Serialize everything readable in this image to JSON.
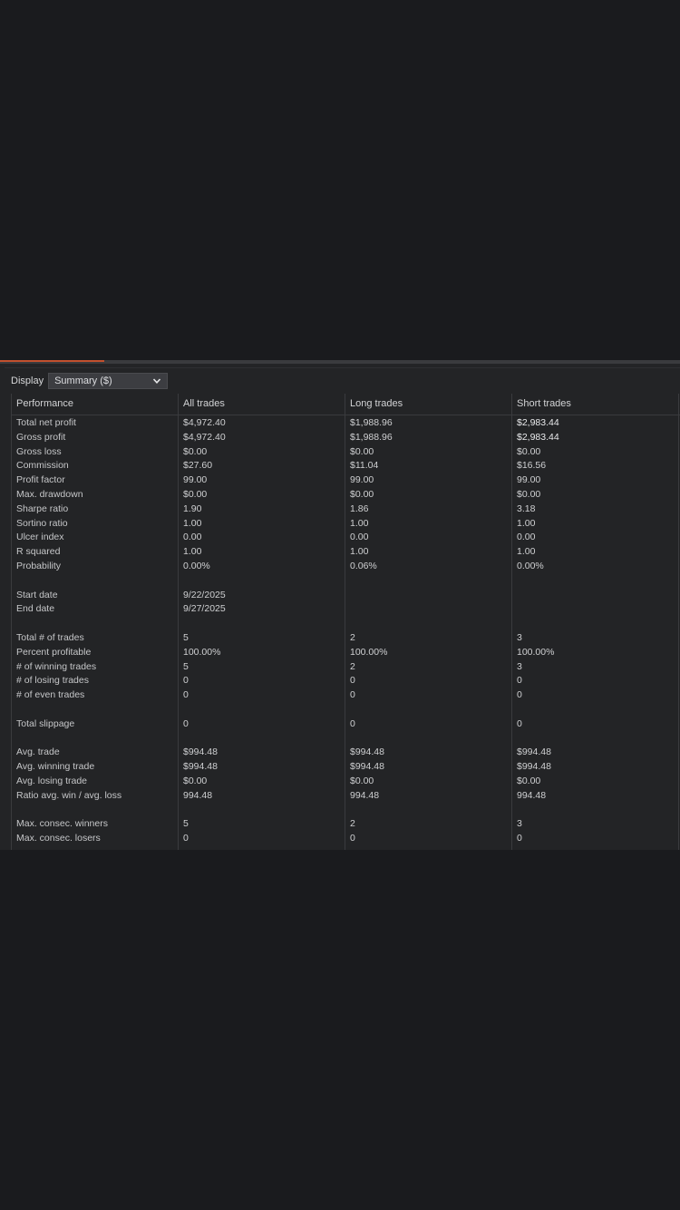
{
  "display": {
    "label": "Display",
    "selected": "Summary ($)",
    "dropdown_icon": "chevron-down-icon"
  },
  "colors": {
    "background": "#1a1b1e",
    "panel": "#232426",
    "accent": "#c2502e",
    "grid": "#3a3b3e",
    "text": "#cfd0d2"
  },
  "table": {
    "headers": [
      "Performance",
      "All trades",
      "Long trades",
      "Short trades"
    ],
    "rows": [
      {
        "label": "Total net profit",
        "all": "$4,972.40",
        "long": "$1,988.96",
        "short": "$2,983.44"
      },
      {
        "label": "Gross profit",
        "all": "$4,972.40",
        "long": "$1,988.96",
        "short": "$2,983.44"
      },
      {
        "label": "Gross loss",
        "all": "$0.00",
        "long": "$0.00",
        "short": "$0.00"
      },
      {
        "label": "Commission",
        "all": "$27.60",
        "long": "$11.04",
        "short": "$16.56"
      },
      {
        "label": "Profit factor",
        "all": "99.00",
        "long": "99.00",
        "short": "99.00"
      },
      {
        "label": "Max. drawdown",
        "all": "$0.00",
        "long": "$0.00",
        "short": "$0.00"
      },
      {
        "label": "Sharpe ratio",
        "all": "1.90",
        "long": "1.86",
        "short": "3.18"
      },
      {
        "label": "Sortino ratio",
        "all": "1.00",
        "long": "1.00",
        "short": "1.00"
      },
      {
        "label": "Ulcer index",
        "all": "0.00",
        "long": "0.00",
        "short": "0.00"
      },
      {
        "label": "R squared",
        "all": "1.00",
        "long": "1.00",
        "short": "1.00"
      },
      {
        "label": "Probability",
        "all": "0.00%",
        "long": "0.06%",
        "short": "0.00%"
      },
      {
        "label": "",
        "all": "",
        "long": "",
        "short": ""
      },
      {
        "label": "Start date",
        "all": "9/22/2025",
        "long": "",
        "short": ""
      },
      {
        "label": "End date",
        "all": "9/27/2025",
        "long": "",
        "short": ""
      },
      {
        "label": "",
        "all": "",
        "long": "",
        "short": ""
      },
      {
        "label": "Total # of trades",
        "all": "5",
        "long": "2",
        "short": "3"
      },
      {
        "label": "Percent profitable",
        "all": "100.00%",
        "long": "100.00%",
        "short": "100.00%"
      },
      {
        "label": "# of winning trades",
        "all": "5",
        "long": "2",
        "short": "3"
      },
      {
        "label": "# of losing trades",
        "all": "0",
        "long": "0",
        "short": "0"
      },
      {
        "label": "# of even trades",
        "all": "0",
        "long": "0",
        "short": "0"
      },
      {
        "label": "",
        "all": "",
        "long": "",
        "short": ""
      },
      {
        "label": "Total slippage",
        "all": "0",
        "long": "0",
        "short": "0"
      },
      {
        "label": "",
        "all": "",
        "long": "",
        "short": ""
      },
      {
        "label": "Avg. trade",
        "all": "$994.48",
        "long": "$994.48",
        "short": "$994.48"
      },
      {
        "label": "Avg. winning trade",
        "all": "$994.48",
        "long": "$994.48",
        "short": "$994.48"
      },
      {
        "label": "Avg. losing trade",
        "all": "$0.00",
        "long": "$0.00",
        "short": "$0.00"
      },
      {
        "label": "Ratio avg. win / avg. loss",
        "all": "994.48",
        "long": "994.48",
        "short": "994.48"
      },
      {
        "label": "",
        "all": "",
        "long": "",
        "short": ""
      },
      {
        "label": "Max. consec. winners",
        "all": "5",
        "long": "2",
        "short": "3"
      },
      {
        "label": "Max. consec. losers",
        "all": "0",
        "long": "0",
        "short": "0"
      }
    ]
  }
}
